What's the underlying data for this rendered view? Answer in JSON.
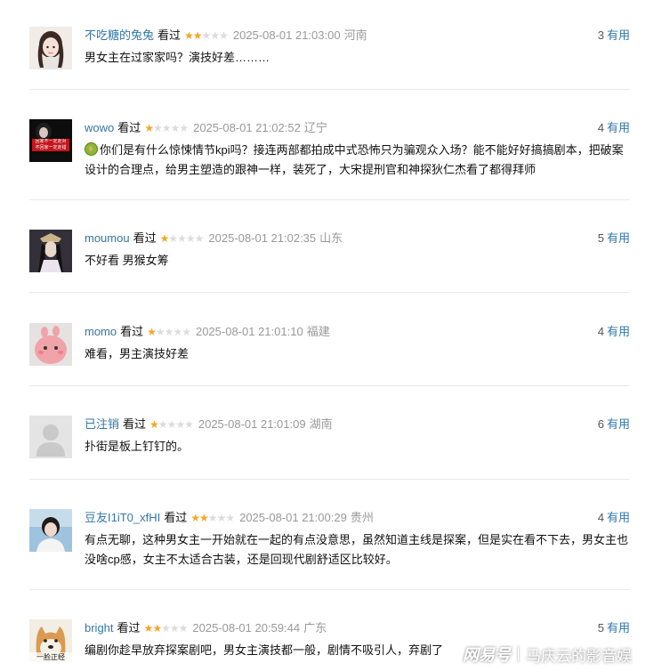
{
  "comments": [
    {
      "user": "不吃糖的兔兔",
      "status": "看过",
      "rating": 2,
      "time": "2025-08-01 21:03:00",
      "location": "河南",
      "votes": "3",
      "useful_label": "有用",
      "content": "男女主在过家家吗？演技好差………",
      "avatar": "avatar-woman-light"
    },
    {
      "user": "wowo",
      "status": "看过",
      "rating": 1,
      "time": "2025-08-01 21:02:52",
      "location": "辽宁",
      "votes": "4",
      "useful_label": "有用",
      "content": "你们是有什么惊悚情节kpi吗？接连两部都拍成中式恐怖只为骗观众入场？能不能好好搞搞剧本，把破案设计的合理点，给男主塑造的跟神一样，装死了，大宋提刑官和神探狄仁杰看了都得拜师",
      "avatar": "avatar-dark-red-sign",
      "avatar_text": "回家不一定走对 不回家一定走错"
    },
    {
      "user": "moumou",
      "status": "看过",
      "rating": 1,
      "time": "2025-08-01 21:02:35",
      "location": "山东",
      "votes": "5",
      "useful_label": "有用",
      "content": "不好看 男猴女筹",
      "avatar": "avatar-costume"
    },
    {
      "user": "momo",
      "status": "看过",
      "rating": 1,
      "time": "2025-08-01 21:01:10",
      "location": "福建",
      "votes": "4",
      "useful_label": "有用",
      "content": "难看，男主演技好差",
      "avatar": "avatar-pink-blob"
    },
    {
      "user": "已注销",
      "status": "看过",
      "rating": 1,
      "time": "2025-08-01 21:01:09",
      "location": "湖南",
      "votes": "6",
      "useful_label": "有用",
      "content": "扑街是板上钉钉的。",
      "avatar": "avatar-default"
    },
    {
      "user": "豆友I1iT0_xfHI",
      "status": "看过",
      "rating": 2,
      "time": "2025-08-01 21:00:29",
      "location": "贵州",
      "votes": "4",
      "useful_label": "有用",
      "content": "有点无聊，这种男女主一开始就在一起的有点没意思，虽然知道主线是探案，但是实在看不下去，男女主也没啥cp感，女主不太适合古装，还是回现代剧舒适区比较好。",
      "avatar": "avatar-girl-outdoor"
    },
    {
      "user": "bright",
      "status": "看过",
      "rating": 2,
      "time": "2025-08-01 20:59:44",
      "location": "广东",
      "votes": "5",
      "useful_label": "有用",
      "content": "编剧你趁早放弃探案剧吧，男女主演技都一般，剧情不吸引人，弃剧了",
      "avatar": "avatar-shiba",
      "avatar_text": "一脸正经"
    }
  ],
  "watermark": {
    "logo": "网易号",
    "author": "马庆云的影音娱"
  },
  "colors": {
    "link": "#3377aa",
    "star_on": "#f5a623",
    "star_off": "#dcdcdc",
    "muted": "#999999"
  }
}
